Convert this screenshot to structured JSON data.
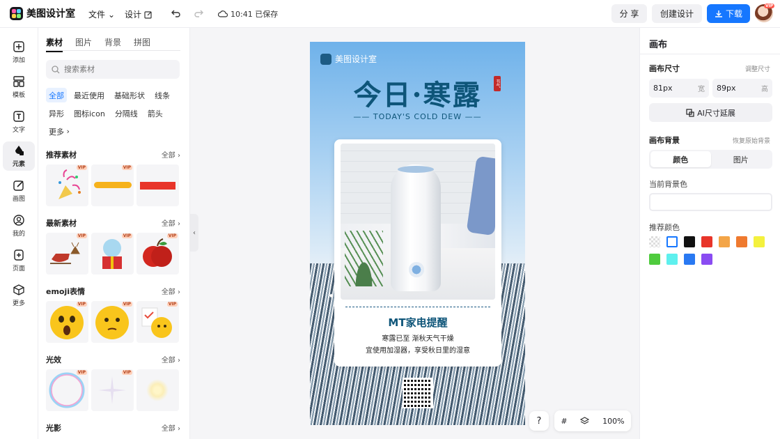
{
  "app": {
    "title": "美图设计室"
  },
  "topbar": {
    "file_menu": "文件",
    "design_menu": "设计",
    "save_status": "10:41 已保存",
    "share_label": "分 享",
    "create_label": "创建设计",
    "download_label": "下载",
    "vip_badge": "VIP"
  },
  "rail": {
    "items": [
      {
        "label": "添加",
        "icon": "plus-square-icon"
      },
      {
        "label": "模板",
        "icon": "template-icon"
      },
      {
        "label": "文字",
        "icon": "text-icon"
      },
      {
        "label": "元素",
        "icon": "element-icon"
      },
      {
        "label": "画图",
        "icon": "draw-icon"
      },
      {
        "label": "我的",
        "icon": "user-icon"
      },
      {
        "label": "页面",
        "icon": "page-icon"
      },
      {
        "label": "更多",
        "icon": "cube-icon"
      }
    ]
  },
  "panel": {
    "tabs": [
      "素材",
      "图片",
      "背景",
      "拼图"
    ],
    "search_placeholder": "搜索素材",
    "chips": [
      "全部",
      "最近使用",
      "基础形状",
      "线条",
      "异形",
      "图标icon",
      "分隔线",
      "箭头",
      "更多"
    ],
    "all_label": "全部",
    "vip": "VIP",
    "sections": [
      {
        "title": "推荐素材"
      },
      {
        "title": "最新素材"
      },
      {
        "title": "emoji表情"
      },
      {
        "title": "光效"
      },
      {
        "title": "光影"
      }
    ]
  },
  "poster": {
    "brand": "美图设计室",
    "title": "今日·寒露",
    "seal": "节气",
    "subtitle": "—— TODAY'S COLD DEW ——",
    "card_title": "MT家电提醒",
    "card_line1": "寒露已至 渐秋天气干燥",
    "card_line2": "宜使用加湿器，享受秋日里的湿意"
  },
  "bottom": {
    "help": "?",
    "zoom": "100%"
  },
  "right": {
    "title": "画布",
    "size_label": "画布尺寸",
    "adjust_size": "调整尺寸",
    "width_value": "81px",
    "width_unit": "宽",
    "height_value": "89px",
    "height_unit": "高",
    "ai_extend": "AI尺寸延展",
    "bg_label": "画布背景",
    "restore_bg": "恢复原始背景",
    "seg_color": "颜色",
    "seg_image": "图片",
    "current_bg": "当前背景色",
    "recommend": "推荐颜色",
    "swatch_colors": [
      "transparent",
      "#ffffff",
      "#111111",
      "#e8352a",
      "#f3a548",
      "#ef7a2f",
      "#f4f13e",
      "#4fcb3e",
      "#5ef0ee",
      "#2979f2",
      "#8a4cf2"
    ]
  }
}
